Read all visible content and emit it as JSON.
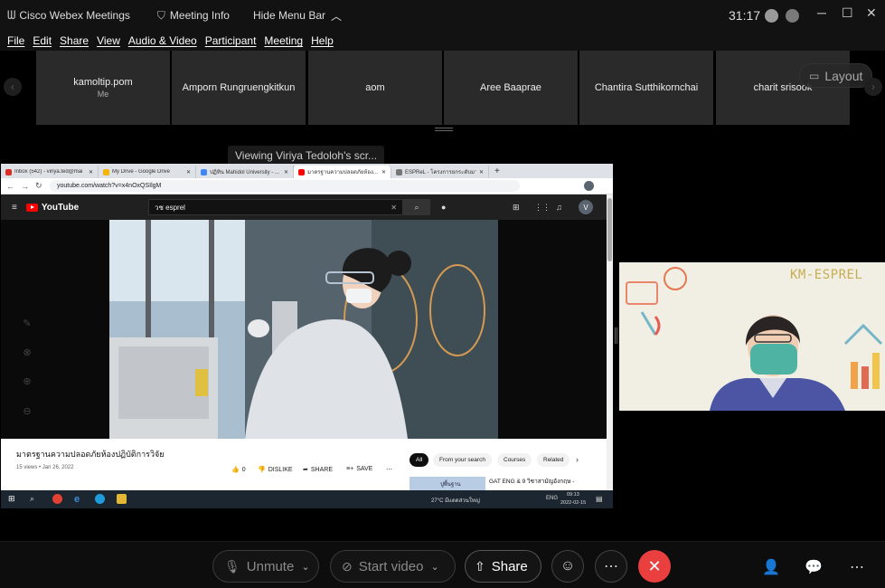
{
  "titlebar": {
    "app_name": "Cisco Webex Meetings",
    "meeting_info": "Meeting Info",
    "hide_menu_bar": "Hide Menu Bar",
    "timer": "31:17"
  },
  "menu": [
    "File",
    "Edit",
    "Share",
    "View",
    "Audio & Video",
    "Participant",
    "Meeting",
    "Help"
  ],
  "participants": [
    {
      "name": "kamoltip.pom",
      "tag": "Me"
    },
    {
      "name": "Amporn Rungruengkitkun",
      "tag": ""
    },
    {
      "name": "aom",
      "tag": ""
    },
    {
      "name": "Aree Baaprae",
      "tag": ""
    },
    {
      "name": "Chantira Sutthikornchai",
      "tag": ""
    },
    {
      "name": "charit srisook",
      "tag": ""
    }
  ],
  "layout_label": "Layout",
  "viewing_label": "Viewing Viriya Tedoloh's scr...",
  "browser": {
    "tabs": [
      {
        "label": "Inbox (542) - viriya.ted@mai",
        "color": "#d93025"
      },
      {
        "label": "My Drive - Google Drive",
        "color": "#f4b400"
      },
      {
        "label": "ปฏิทิน Mahidol University - ...",
        "color": "#4285f4"
      },
      {
        "label": "มาตรฐานความปลอดภัยห้อง...",
        "color": "#ff0000"
      },
      {
        "label": "ESPReL - โครงการยกระดับมาตร...",
        "color": "#777777"
      }
    ],
    "url": "youtube.com/watch?v=x4nOxQSIlgM"
  },
  "youtube": {
    "search_value": "วช esprel",
    "avatar_letter": "V",
    "video_title": "มาตรฐานความปลอดภัยห้องปฏิบัติการวิจัย",
    "meta": "15 views • Jan 26, 2022",
    "likes": "0",
    "dislike": "DISLIKE",
    "share": "SHARE",
    "save": "SAVE",
    "chips": [
      "All",
      "From your search",
      "Courses",
      "Related"
    ],
    "suggestion_title": "GAT ENG & 9 วิชาสามัญอังกฤษ -",
    "suggestion_thumb_text": "ปูพื้นฐาน"
  },
  "taskbar": {
    "weather": "27°C มีแดดส่วนใหญ่",
    "lang": "ENG",
    "time": "09:13",
    "date": "2022-02-15"
  },
  "presenter": {
    "title": "KM-ESPREL"
  },
  "controls": {
    "unmute": "Unmute",
    "start_video": "Start video",
    "share": "Share"
  },
  "colors": {
    "end_call": "#ea3f3f",
    "youtube_red": "#ff0000"
  }
}
